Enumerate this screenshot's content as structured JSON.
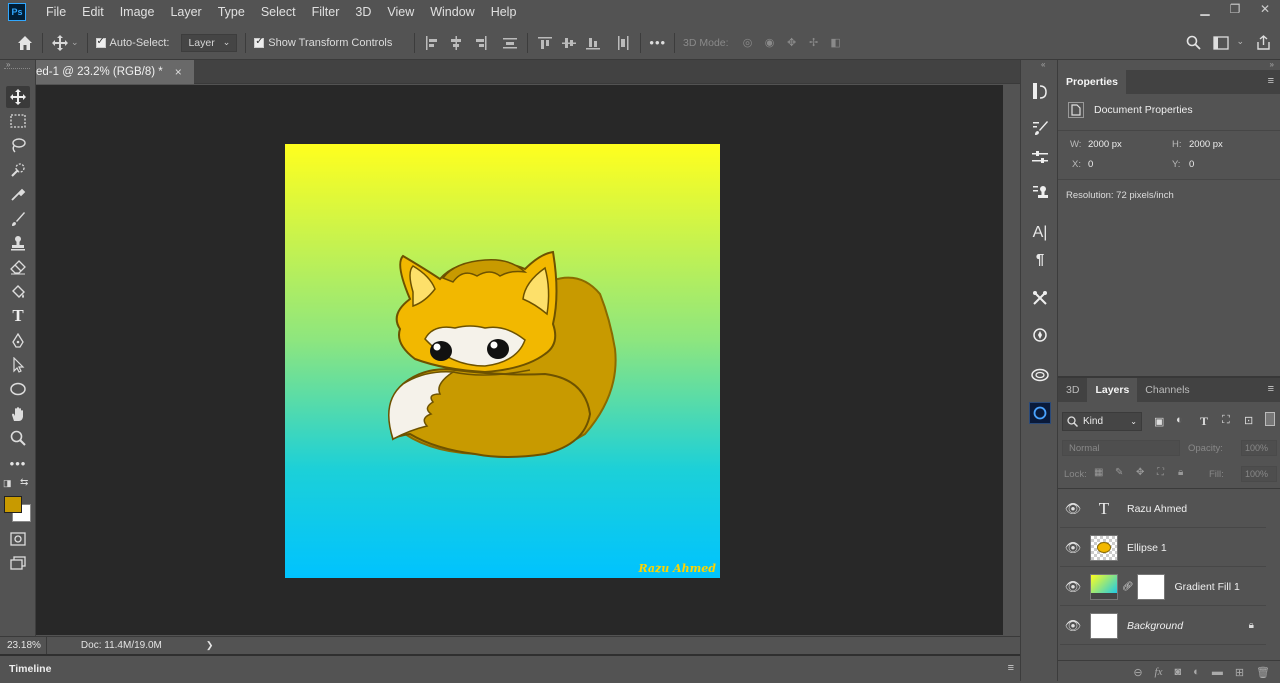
{
  "menubar": {
    "logo": "Ps",
    "items": [
      "File",
      "Edit",
      "Image",
      "Layer",
      "Type",
      "Select",
      "Filter",
      "3D",
      "View",
      "Window",
      "Help"
    ]
  },
  "options": {
    "auto_select_label": "Auto-Select:",
    "auto_select_value": "Layer",
    "transform_label": "Show Transform Controls",
    "mode_label": "3D Mode:",
    "more": "•••"
  },
  "document": {
    "tab_title": "ed-1 @ 23.2% (RGB/8) *",
    "close": "×",
    "watermark": "Razu Ahmed"
  },
  "status": {
    "zoom": "23.18%",
    "doc": "Doc: 11.4M/19.0M",
    "arrow": "❯"
  },
  "timeline": {
    "label": "Timeline"
  },
  "properties": {
    "tab": "Properties",
    "section": "Document Properties",
    "w_label": "W:",
    "w_value": "2000 px",
    "h_label": "H:",
    "h_value": "2000 px",
    "x_label": "X:",
    "x_value": "0",
    "y_label": "Y:",
    "y_value": "0",
    "resolution": "Resolution: 72 pixels/inch"
  },
  "layers_panel": {
    "tabs": [
      "3D",
      "Layers",
      "Channels"
    ],
    "kind": "Kind",
    "blend": "Normal",
    "opacity_label": "Opacity:",
    "opacity_value": "100%",
    "lock_label": "Lock:",
    "fill_label": "Fill:",
    "fill_value": "100%",
    "layers": [
      {
        "name": "Razu Ahmed",
        "type": "text"
      },
      {
        "name": "Ellipse 1",
        "type": "shape"
      },
      {
        "name": "Gradient Fill 1",
        "type": "gradient"
      },
      {
        "name": "Background",
        "type": "background"
      }
    ]
  },
  "colors": {
    "foreground": "#c89a00",
    "background": "#ffffff",
    "fox_main": "#f2b800",
    "fox_dark": "#c89a00",
    "accent": "#31a8ff"
  }
}
